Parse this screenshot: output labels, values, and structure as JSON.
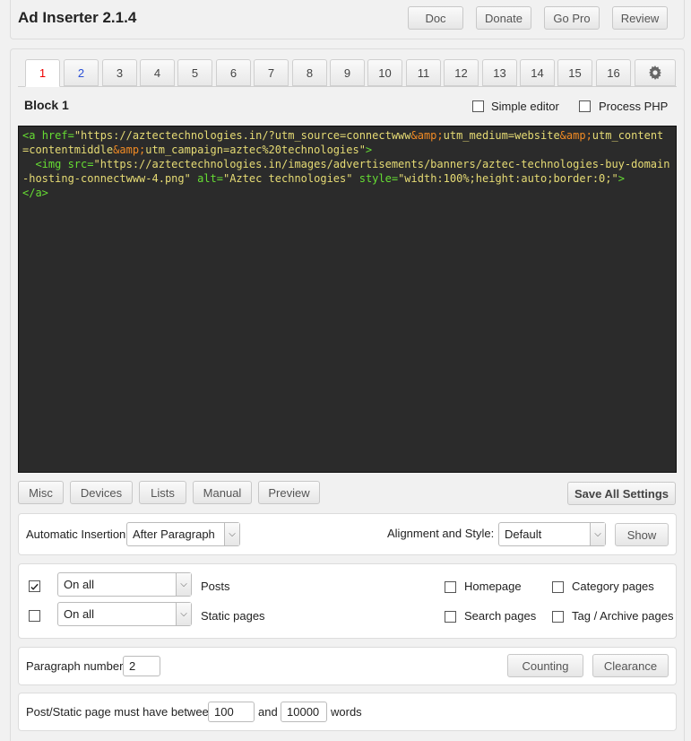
{
  "header": {
    "title": "Ad Inserter 2.1.4",
    "buttons": [
      "Doc",
      "Donate",
      "Go Pro",
      "Review"
    ]
  },
  "tabs": [
    "1",
    "2",
    "3",
    "4",
    "5",
    "6",
    "7",
    "8",
    "9",
    "10",
    "11",
    "12",
    "13",
    "14",
    "15",
    "16"
  ],
  "active_tab": "1",
  "block": {
    "title": "Block 1",
    "simple_editor_label": "Simple editor",
    "simple_editor_checked": false,
    "process_php_label": "Process PHP",
    "process_php_checked": false
  },
  "code": {
    "line1_tag_open": "<a ",
    "line1_attr": "href=",
    "line1_val_a": "\"https://aztectechnologies.in/?utm_source=connectwww",
    "line1_ent1": "&amp;",
    "line1_val_b": "utm_medium=website",
    "line1_ent2": "&amp;",
    "line1_val_c": "utm_content",
    "line2_val_a": "=contentmiddle",
    "line2_ent": "&amp;",
    "line2_val_b": "utm_campaign=aztec%20technologies\"",
    "line2_close": ">",
    "line3_tag": "  <img ",
    "line3_attr": "src=",
    "line3_val": "\"https://aztectechnologies.in/images/advertisements/banners/aztec-technologies-buy-domain",
    "line4_val": "-hosting-connectwww-4.png\"",
    "line4_attr_alt": "alt=",
    "line4_alt_val": "\"Aztec technologies\"",
    "line4_attr_style": "style=",
    "line4_style_val": "\"width:100%;height:auto;border:0;\"",
    "line4_close": ">",
    "line5": "</a>"
  },
  "toolbar": {
    "buttons": [
      "Misc",
      "Devices",
      "Lists",
      "Manual",
      "Preview"
    ],
    "save_all": "Save All Settings"
  },
  "insertion": {
    "automatic_label": "Automatic Insertion:",
    "automatic_value": "After Paragraph",
    "alignment_label": "Alignment and Style:",
    "alignment_value": "Default",
    "show_button": "Show"
  },
  "pages": {
    "posts_checked": true,
    "posts_select": "On all",
    "posts_label": "Posts",
    "static_checked": false,
    "static_select": "On all",
    "static_label": "Static pages",
    "homepage_label": "Homepage",
    "category_label": "Category pages",
    "search_label": "Search pages",
    "tag_archive_label": "Tag / Archive pages"
  },
  "paragraph": {
    "label": "Paragraph number",
    "value": "2",
    "counting_button": "Counting",
    "clearance_button": "Clearance"
  },
  "words": {
    "label_before": "Post/Static page must have between",
    "min": "100",
    "label_and": "and",
    "max": "10000",
    "label_after": "words"
  },
  "icons": {
    "settings_tab": "gear-icon",
    "select_arrow": "chevron-down-icon",
    "checkmark": "check-icon"
  }
}
